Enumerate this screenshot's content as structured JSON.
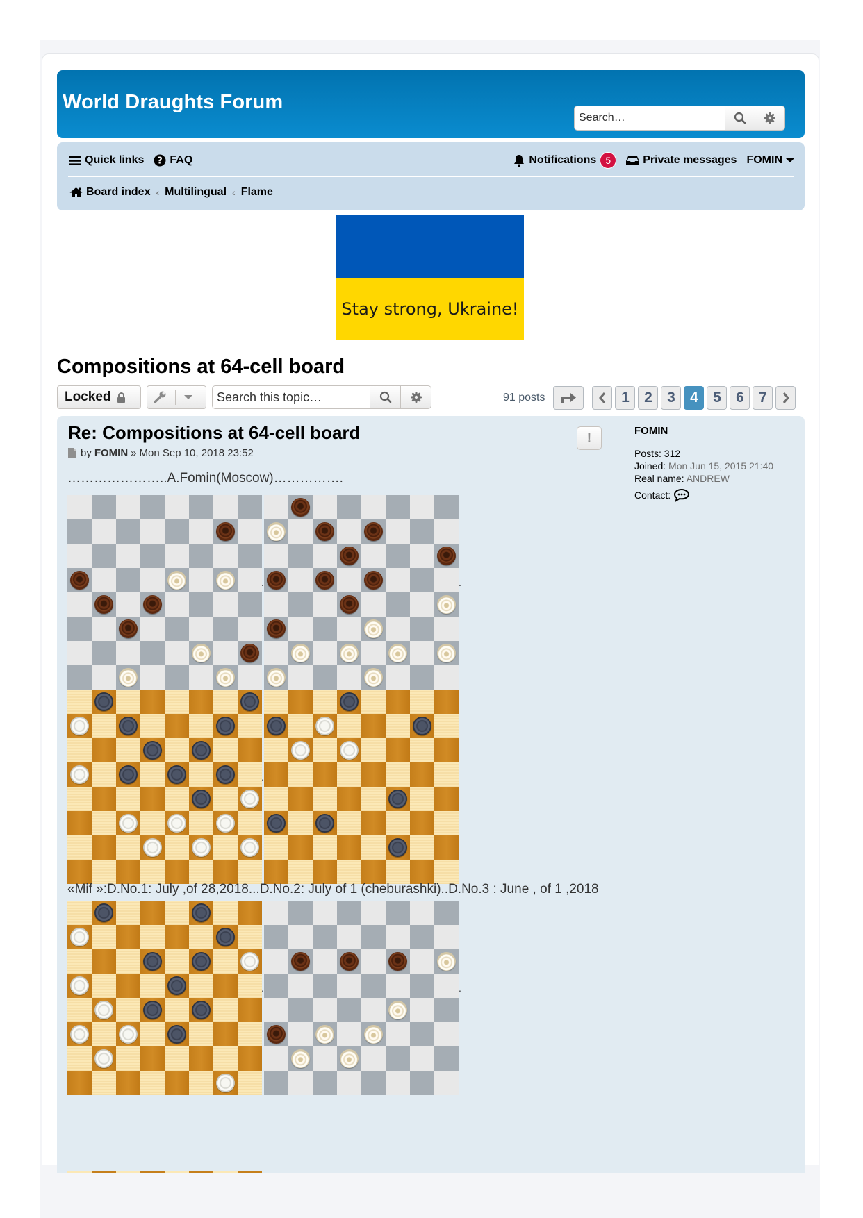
{
  "header": {
    "site_title": "World Draughts Forum",
    "search_placeholder": "Search…",
    "search_icon": "search-icon",
    "advanced_search_icon": "gear-icon"
  },
  "navbar": {
    "quick_links": "Quick links",
    "faq": "FAQ",
    "notifications": "Notifications",
    "notifications_count": "5",
    "private_messages": "Private messages",
    "username": "FOMIN",
    "breadcrumbs": [
      "Board index",
      "Multilingual",
      "Flame"
    ]
  },
  "banner": {
    "text": "Stay strong, Ukraine!",
    "colors": {
      "top": "#0057b8",
      "bottom": "#ffd700"
    }
  },
  "topic": {
    "title": "Compositions at 64-cell board",
    "locked_label": "Locked",
    "search_placeholder": "Search this topic…",
    "post_count": "91 posts",
    "pages": [
      "1",
      "2",
      "3",
      "4",
      "5",
      "6",
      "7"
    ],
    "current_page": "4"
  },
  "post": {
    "title": "Re: Compositions at 64-cell board",
    "by_label": "by",
    "author": "FOMIN",
    "date_sep": "»",
    "date": "Mon Sep 10, 2018 23:52",
    "intro_line": "…………………..A.Fomin(Moscow)…………….",
    "caption_line": "«Mif »:D.No.1: July ,of 28,2018...D.No.2: July of 1 (cheburashki)..D.No.3 : June , of 1 ,2018",
    "boards": [
      {
        "style": "gray",
        "pieces": {
          "b": [
            [
              1,
              6
            ],
            [
              3,
              0
            ],
            [
              4,
              1
            ],
            [
              4,
              3
            ],
            [
              5,
              2
            ],
            [
              6,
              7
            ]
          ],
          "w": [
            [
              3,
              4
            ],
            [
              3,
              6
            ],
            [
              6,
              5
            ],
            [
              7,
              2
            ],
            [
              7,
              6
            ]
          ]
        }
      },
      {
        "style": "gray",
        "pieces": {
          "b": [
            [
              0,
              1
            ],
            [
              1,
              2
            ],
            [
              1,
              4
            ],
            [
              2,
              3
            ],
            [
              2,
              7
            ],
            [
              3,
              0
            ],
            [
              3,
              2
            ],
            [
              3,
              4
            ],
            [
              4,
              3
            ],
            [
              5,
              0
            ]
          ],
          "w": [
            [
              1,
              0
            ],
            [
              4,
              7
            ],
            [
              5,
              4
            ],
            [
              6,
              1
            ],
            [
              6,
              3
            ],
            [
              6,
              5
            ],
            [
              6,
              7
            ],
            [
              7,
              0
            ],
            [
              7,
              4
            ]
          ]
        }
      },
      {
        "style": "wood",
        "pieces": {
          "b": [
            [
              0,
              1
            ],
            [
              0,
              7
            ],
            [
              1,
              2
            ],
            [
              1,
              6
            ],
            [
              2,
              3
            ],
            [
              2,
              5
            ],
            [
              3,
              2
            ],
            [
              3,
              4
            ],
            [
              3,
              6
            ],
            [
              4,
              5
            ]
          ],
          "w": [
            [
              1,
              0
            ],
            [
              3,
              0
            ],
            [
              4,
              7
            ],
            [
              5,
              2
            ],
            [
              5,
              4
            ],
            [
              5,
              6
            ],
            [
              6,
              3
            ],
            [
              6,
              5
            ],
            [
              6,
              7
            ]
          ]
        }
      },
      {
        "style": "wood",
        "pieces": {
          "b": [
            [
              0,
              3
            ],
            [
              1,
              0
            ],
            [
              1,
              6
            ],
            [
              4,
              5
            ],
            [
              5,
              0
            ],
            [
              5,
              2
            ],
            [
              6,
              5
            ]
          ],
          "w": [
            [
              1,
              2
            ],
            [
              2,
              1
            ],
            [
              2,
              3
            ]
          ]
        }
      },
      {
        "style": "wood",
        "pieces": {
          "b": [
            [
              0,
              1
            ],
            [
              0,
              5
            ],
            [
              1,
              6
            ],
            [
              2,
              3
            ],
            [
              2,
              5
            ],
            [
              3,
              4
            ],
            [
              4,
              3
            ],
            [
              4,
              5
            ],
            [
              5,
              4
            ]
          ],
          "w": [
            [
              1,
              0
            ],
            [
              2,
              7
            ],
            [
              3,
              0
            ],
            [
              4,
              1
            ],
            [
              5,
              0
            ],
            [
              5,
              2
            ],
            [
              6,
              1
            ],
            [
              7,
              6
            ]
          ]
        }
      },
      {
        "style": "gray",
        "pieces": {
          "b": [
            [
              2,
              1
            ],
            [
              2,
              3
            ],
            [
              2,
              5
            ],
            [
              5,
              0
            ]
          ],
          "w": [
            [
              2,
              7
            ],
            [
              4,
              5
            ],
            [
              5,
              2
            ],
            [
              5,
              4
            ],
            [
              6,
              1
            ],
            [
              6,
              3
            ]
          ]
        }
      }
    ]
  },
  "profile": {
    "username": "FOMIN",
    "posts_label": "Posts:",
    "posts": "312",
    "joined_label": "Joined:",
    "joined": "Mon Jun 15, 2015 21:40",
    "realname_label": "Real name:",
    "realname": "ANDREW",
    "contact_label": "Contact:"
  }
}
